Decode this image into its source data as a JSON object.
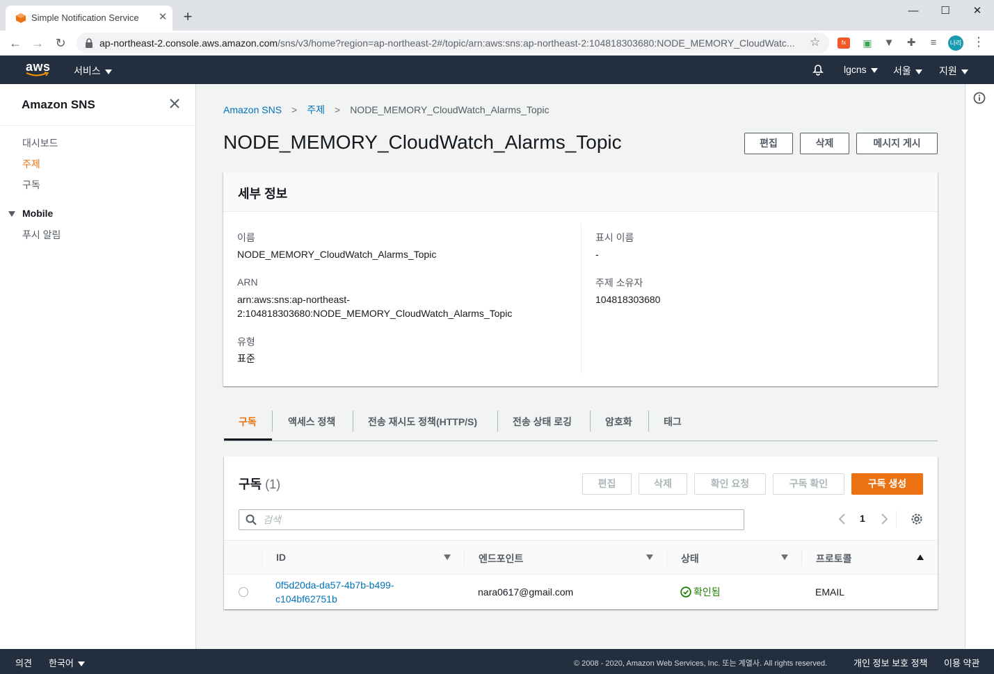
{
  "browser": {
    "tab_title": "Simple Notification Service",
    "url_host": "ap-northeast-2.console.aws.amazon.com",
    "url_path": "/sns/v3/home?region=ap-northeast-2#/topic/arn:aws:sns:ap-northeast-2:104818303680:NODE_MEMORY_CloudWatc...",
    "profile_initials": "나리"
  },
  "awsnav": {
    "logo": "aws",
    "services": "서비스",
    "account": "lgcns",
    "region": "서울",
    "support": "지원"
  },
  "sidebar": {
    "title": "Amazon SNS",
    "items": [
      {
        "label": "대시보드",
        "active": false
      },
      {
        "label": "주제",
        "active": true
      },
      {
        "label": "구독",
        "active": false
      }
    ],
    "section": "Mobile",
    "section_items": [
      {
        "label": "푸시 알림"
      }
    ]
  },
  "breadcrumb": {
    "root": "Amazon SNS",
    "parent": "주제",
    "current": "NODE_MEMORY_CloudWatch_Alarms_Topic"
  },
  "page": {
    "title": "NODE_MEMORY_CloudWatch_Alarms_Topic",
    "edit_label": "편집",
    "delete_label": "삭제",
    "publish_label": "메시지 게시"
  },
  "details": {
    "heading": "세부 정보",
    "name_label": "이름",
    "name_value": "NODE_MEMORY_CloudWatch_Alarms_Topic",
    "arn_label": "ARN",
    "arn_value_line1": "arn:aws:sns:ap-northeast-",
    "arn_value_line2": "2:104818303680:NODE_MEMORY_CloudWatch_Alarms_Topic",
    "type_label": "유형",
    "type_value": "표준",
    "display_name_label": "표시 이름",
    "display_name_value": "-",
    "owner_label": "주제 소유자",
    "owner_value": "104818303680"
  },
  "tabs": [
    {
      "label": "구독",
      "active": true
    },
    {
      "label": "액세스 정책"
    },
    {
      "label": "전송 재시도 정책(HTTP/S)"
    },
    {
      "label": "전송 상태 로깅"
    },
    {
      "label": "암호화"
    },
    {
      "label": "태그"
    }
  ],
  "subscriptions": {
    "title": "구독",
    "count": "(1)",
    "edit_label": "편집",
    "delete_label": "삭제",
    "request_confirm_label": "확인 요청",
    "confirm_label": "구독 확인",
    "create_label": "구독 생성",
    "search_placeholder": "검색",
    "page": "1",
    "columns": [
      "ID",
      "엔드포인트",
      "상태",
      "프로토콜"
    ],
    "rows": [
      {
        "id_line1": "0f5d20da-da57-4b7b-b499-",
        "id_line2": "c104bf62751b",
        "endpoint": "nara0617@gmail.com",
        "status": "확인됨",
        "protocol": "EMAIL"
      }
    ]
  },
  "footer": {
    "feedback": "의견",
    "language": "한국어",
    "copyright": "© 2008 - 2020, Amazon Web Services, Inc. 또는 계열사. All rights reserved.",
    "privacy": "개인 정보 보호 정책",
    "terms": "이용 약관"
  },
  "colors": {
    "accent": "#ec7211",
    "link": "#0073bb",
    "nav_bg": "#232f3e",
    "success": "#1d8102"
  }
}
